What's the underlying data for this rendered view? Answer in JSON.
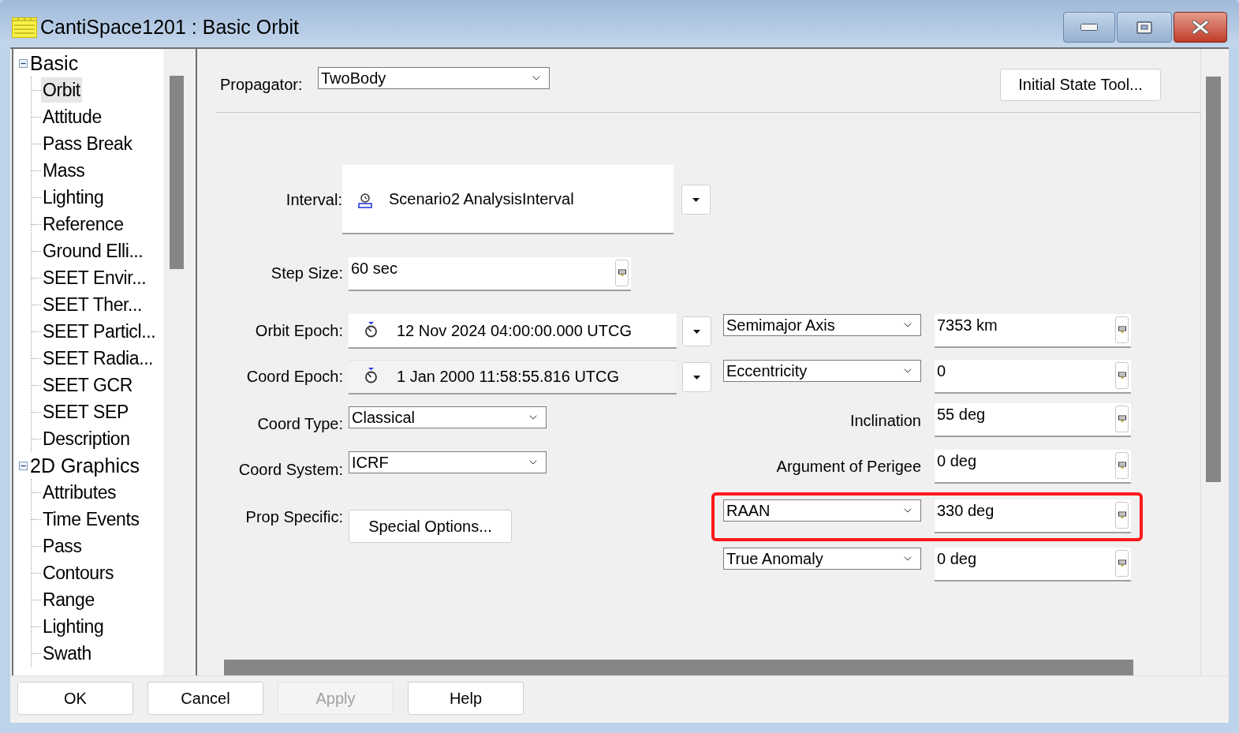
{
  "window": {
    "title": "CantiSpace1201 : Basic Orbit"
  },
  "tree": [
    {
      "label": "Basic",
      "expanded": true,
      "children": [
        {
          "label": "Orbit",
          "selected": true
        },
        {
          "label": "Attitude",
          "selected": false
        },
        {
          "label": "Pass Break",
          "selected": false
        },
        {
          "label": "Mass",
          "selected": false
        },
        {
          "label": "Lighting",
          "selected": false
        },
        {
          "label": "Reference",
          "selected": false
        },
        {
          "label": "Ground Elli...",
          "selected": false
        },
        {
          "label": "SEET Envir...",
          "selected": false
        },
        {
          "label": "SEET Ther...",
          "selected": false
        },
        {
          "label": "SEET Particl...",
          "selected": false
        },
        {
          "label": "SEET Radia...",
          "selected": false
        },
        {
          "label": "SEET GCR",
          "selected": false
        },
        {
          "label": "SEET SEP",
          "selected": false
        },
        {
          "label": "Description",
          "selected": false
        }
      ]
    },
    {
      "label": "2D Graphics",
      "expanded": true,
      "children": [
        {
          "label": "Attributes",
          "selected": false
        },
        {
          "label": "Time Events",
          "selected": false
        },
        {
          "label": "Pass",
          "selected": false
        },
        {
          "label": "Contours",
          "selected": false
        },
        {
          "label": "Range",
          "selected": false
        },
        {
          "label": "Lighting",
          "selected": false
        },
        {
          "label": "Swath",
          "selected": false
        }
      ]
    }
  ],
  "propagator": {
    "label": "Propagator:",
    "value": "TwoBody"
  },
  "initial_state_button": "Initial State Tool...",
  "interval": {
    "label": "Interval:",
    "value": "Scenario2 AnalysisInterval"
  },
  "step_size": {
    "label": "Step Size:",
    "value": "60 sec"
  },
  "orbit_epoch": {
    "label": "Orbit Epoch:",
    "value": "12 Nov 2024 04:00:00.000 UTCG",
    "disabled": false
  },
  "coord_epoch": {
    "label": "Coord Epoch:",
    "value": "1 Jan 2000 11:58:55.816 UTCG",
    "disabled": true
  },
  "coord_type": {
    "label": "Coord Type:",
    "value": "Classical"
  },
  "coord_system": {
    "label": "Coord System:",
    "value": "ICRF"
  },
  "prop_specific": {
    "label": "Prop Specific:",
    "button": "Special Options..."
  },
  "elements": [
    {
      "kind": "select",
      "name": "Semimajor Axis",
      "value": "7353 km",
      "highlighted": false
    },
    {
      "kind": "select",
      "name": "Eccentricity",
      "value": "0",
      "highlighted": false
    },
    {
      "kind": "label",
      "name": "Inclination",
      "value": "55 deg",
      "highlighted": false
    },
    {
      "kind": "label",
      "name": "Argument of Perigee",
      "value": "0 deg",
      "highlighted": false
    },
    {
      "kind": "select",
      "name": "RAAN",
      "value": "330 deg",
      "highlighted": true
    },
    {
      "kind": "select",
      "name": "True Anomaly",
      "value": "0 deg",
      "highlighted": false
    }
  ],
  "buttons": [
    {
      "label": "OK",
      "disabled": false
    },
    {
      "label": "Cancel",
      "disabled": false
    },
    {
      "label": "Apply",
      "disabled": true
    },
    {
      "label": "Help",
      "disabled": false
    }
  ]
}
